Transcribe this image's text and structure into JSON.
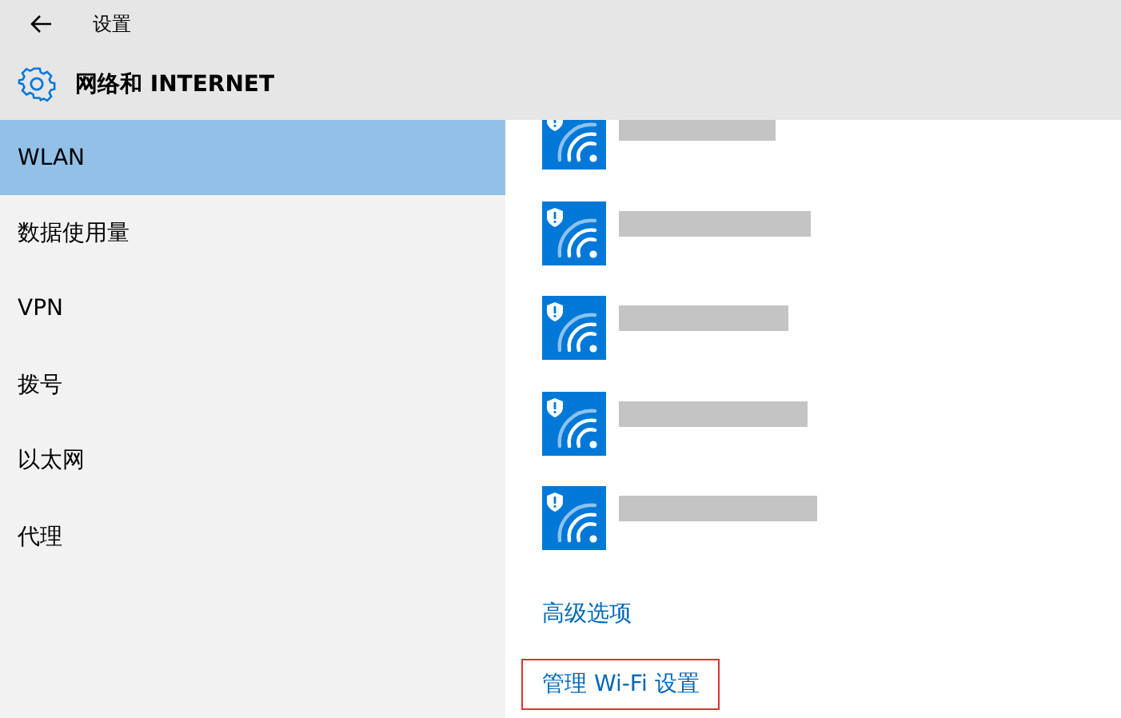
{
  "window": {
    "title": "设置"
  },
  "header": {
    "title": "网络和 INTERNET"
  },
  "sidebar": {
    "items": [
      {
        "label": "WLAN",
        "selected": true
      },
      {
        "label": "数据使用量",
        "selected": false
      },
      {
        "label": "VPN",
        "selected": false
      },
      {
        "label": "拨号",
        "selected": false
      },
      {
        "label": "以太网",
        "selected": false
      },
      {
        "label": "代理",
        "selected": false
      }
    ]
  },
  "networks": [
    {
      "kind": "redacted",
      "secured": true
    },
    {
      "kind": "redacted",
      "secured": true
    },
    {
      "kind": "redacted",
      "secured": true
    },
    {
      "kind": "redacted",
      "secured": true
    },
    {
      "kind": "redacted",
      "secured": true
    }
  ],
  "links": [
    {
      "label": "高级选项",
      "highlighted": false
    },
    {
      "label": "管理 Wi-Fi 设置",
      "highlighted": true
    }
  ]
}
